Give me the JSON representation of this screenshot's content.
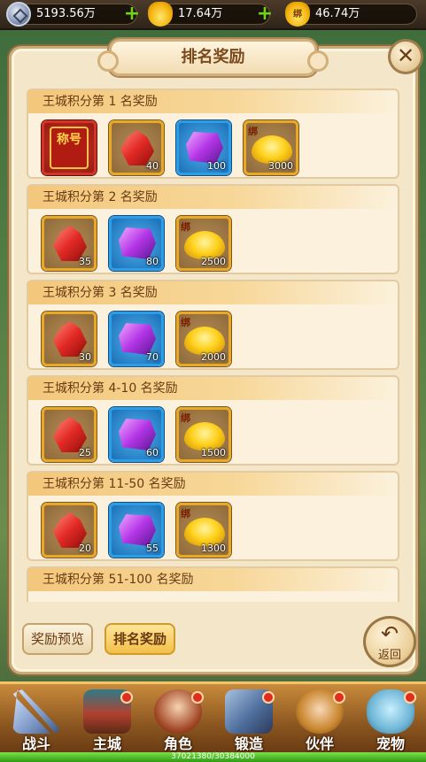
{
  "currencies": [
    {
      "icon": "diamond-coin-icon",
      "value": "5193.56万",
      "has_plus": true
    },
    {
      "icon": "gold-ingot-icon",
      "value": "17.64万",
      "has_plus": true
    },
    {
      "icon": "bound-gold-ingot-icon",
      "icon_text": "绑",
      "value": "46.74万",
      "has_plus": false
    }
  ],
  "dialog": {
    "title": "排名奖励",
    "close_icon": "✕"
  },
  "ranks": [
    {
      "label": "王城积分第 1 名奖励",
      "items": [
        {
          "kind": "title-card",
          "text": "称号",
          "count": ""
        },
        {
          "kind": "red-gem",
          "count": "40"
        },
        {
          "kind": "purple-gem",
          "count": "100"
        },
        {
          "kind": "bound-ingot",
          "tag": "绑",
          "count": "3000"
        }
      ]
    },
    {
      "label": "王城积分第 2 名奖励",
      "items": [
        {
          "kind": "red-gem",
          "count": "35"
        },
        {
          "kind": "purple-gem",
          "count": "80"
        },
        {
          "kind": "bound-ingot",
          "tag": "绑",
          "count": "2500"
        }
      ]
    },
    {
      "label": "王城积分第 3 名奖励",
      "items": [
        {
          "kind": "red-gem",
          "count": "30"
        },
        {
          "kind": "purple-gem",
          "count": "70"
        },
        {
          "kind": "bound-ingot",
          "tag": "绑",
          "count": "2000"
        }
      ]
    },
    {
      "label": "王城积分第 4-10 名奖励",
      "items": [
        {
          "kind": "red-gem",
          "count": "25"
        },
        {
          "kind": "purple-gem",
          "count": "60"
        },
        {
          "kind": "bound-ingot",
          "tag": "绑",
          "count": "1500"
        }
      ]
    },
    {
      "label": "王城积分第 11-50 名奖励",
      "items": [
        {
          "kind": "red-gem",
          "count": "20"
        },
        {
          "kind": "purple-gem",
          "count": "55"
        },
        {
          "kind": "bound-ingot",
          "tag": "绑",
          "count": "1300"
        }
      ]
    },
    {
      "label": "王城积分第 51-100 名奖励",
      "items": []
    }
  ],
  "buttons": {
    "preview": "奖励预览",
    "rank": "排名奖励",
    "back": "返回",
    "back_icon": "↶"
  },
  "nav": [
    {
      "label": "战斗",
      "icon": "crossed-swords-icon",
      "badge": false
    },
    {
      "label": "主城",
      "icon": "city-gate-icon",
      "badge": true
    },
    {
      "label": "角色",
      "icon": "hero-portrait-icon",
      "badge": true
    },
    {
      "label": "锻造",
      "icon": "forge-anvil-icon",
      "badge": true
    },
    {
      "label": "伙伴",
      "icon": "partner-portrait-icon",
      "badge": true
    },
    {
      "label": "宠物",
      "icon": "pet-cat-icon",
      "badge": true
    }
  ],
  "exp": {
    "text": "37021380/30384000",
    "fraction": 1.0
  }
}
